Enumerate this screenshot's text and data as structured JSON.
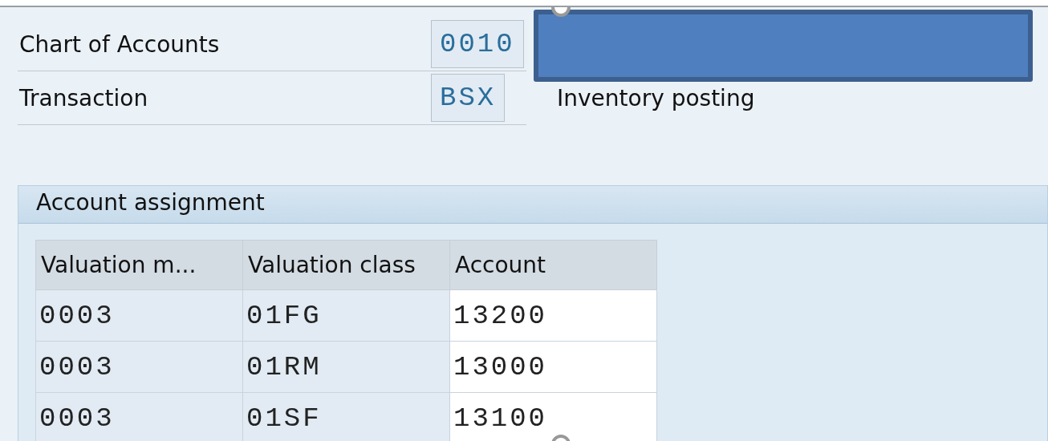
{
  "header_fields": [
    {
      "label": "Chart of Accounts",
      "value": "0010"
    },
    {
      "label": "Transaction",
      "value": "BSX",
      "description": "Inventory posting"
    }
  ],
  "group": {
    "title": "Account assignment",
    "table": {
      "columns": [
        {
          "label": "Valuation m...",
          "editable": false
        },
        {
          "label": "Valuation class",
          "editable": false
        },
        {
          "label": "Account",
          "editable": true
        }
      ],
      "rows": [
        [
          "0003",
          "01FG",
          "13200"
        ],
        [
          "0003",
          "01RM",
          "13000"
        ],
        [
          "0003",
          "01SF",
          "13100"
        ]
      ]
    }
  }
}
